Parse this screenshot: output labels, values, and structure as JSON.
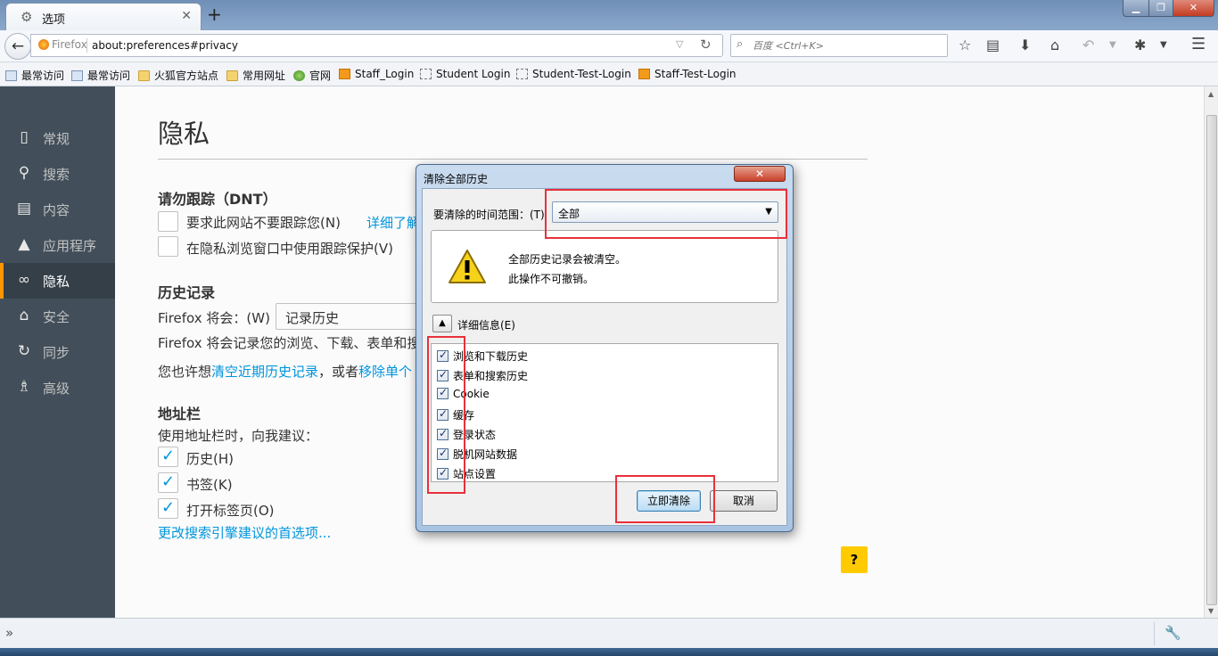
{
  "window": {
    "tab_title": "选项",
    "new_tab": "+",
    "min": "▁",
    "max": "❐",
    "close": "✕"
  },
  "navbar": {
    "back": "←",
    "identity": "Firefox",
    "url": "about:preferences#privacy",
    "search_placeholder": "百度 <Ctrl+K>"
  },
  "bookmarks": [
    {
      "label": "最常访问",
      "icon": "page-icon"
    },
    {
      "label": "最常访问",
      "icon": "page-icon"
    },
    {
      "label": "火狐官方站点",
      "icon": "folder-icon"
    },
    {
      "label": "常用网址",
      "icon": "folder-icon"
    },
    {
      "label": "官网",
      "icon": "globe-icon"
    },
    {
      "label": "Staff_Login",
      "icon": "rss-icon"
    },
    {
      "label": "Student Login",
      "icon": "blank-page-icon"
    },
    {
      "label": "Student-Test-Login",
      "icon": "blank-page-icon"
    },
    {
      "label": "Staff-Test-Login",
      "icon": "rss-icon"
    }
  ],
  "sidebar": {
    "items": [
      {
        "label": "常规",
        "icon": "general-icon"
      },
      {
        "label": "搜索",
        "icon": "search-icon"
      },
      {
        "label": "内容",
        "icon": "content-icon"
      },
      {
        "label": "应用程序",
        "icon": "applications-icon"
      },
      {
        "label": "隐私",
        "icon": "privacy-mask-icon",
        "active": true
      },
      {
        "label": "安全",
        "icon": "security-icon"
      },
      {
        "label": "同步",
        "icon": "sync-icon"
      },
      {
        "label": "高级",
        "icon": "advanced-icon"
      }
    ]
  },
  "main": {
    "title": "隐私",
    "dnt": {
      "heading": "请勿跟踪（DNT）",
      "opt1": "要求此网站不要跟踪您(N)",
      "learn_more": "详细了解",
      "opt2": "在隐私浏览窗口中使用跟踪保护(V)"
    },
    "history": {
      "heading": "历史记录",
      "will_label": "Firefox 将会：(W)",
      "will_value": "记录历史",
      "desc": "Firefox 将会记录您的浏览、下载、表单和搜",
      "maybe_prefix": "您也许想",
      "clear_link": "清空近期历史记录",
      "or_text": "，或者",
      "remove_link": "移除单个"
    },
    "urlbar": {
      "heading": "地址栏",
      "desc": "使用地址栏时，向我建议：",
      "opts": [
        {
          "label": "历史(H)",
          "checked": true
        },
        {
          "label": "书签(K)",
          "checked": true
        },
        {
          "label": "打开标签页(O)",
          "checked": true
        }
      ],
      "search_link": "更改搜索引擎建议的首选项..."
    },
    "help": "?"
  },
  "dialog": {
    "title": "清除全部历史",
    "close": "✕",
    "range_label": "要清除的时间范围：(T)",
    "range_value": "全部",
    "warn_line1": "全部历史记录会被清空。",
    "warn_line2": "此操作不可撤销。",
    "details_label": "详细信息(E)",
    "items": [
      {
        "label": "浏览和下载历史",
        "checked": true
      },
      {
        "label": "表单和搜索历史",
        "checked": true
      },
      {
        "label": "Cookie",
        "checked": true
      },
      {
        "label": "缓存",
        "checked": true
      },
      {
        "label": "登录状态",
        "checked": true
      },
      {
        "label": "脱机网站数据",
        "checked": true
      },
      {
        "label": "站点设置",
        "checked": true
      }
    ],
    "clear_now": "立即清除",
    "cancel": "取消"
  }
}
